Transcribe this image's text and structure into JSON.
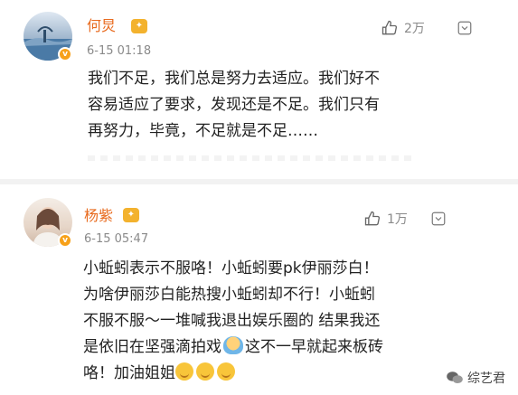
{
  "comments": [
    {
      "user": "何炅",
      "time": "6-15 01:18",
      "likes": "2万",
      "text": [
        "我们不足，我们总是努力去适应。我们好不",
        "容易适应了要求，发现还是不足。我们只有",
        "再努力，毕竟，不足就是不足……"
      ]
    },
    {
      "user": "杨紫",
      "time": "6-15 05:47",
      "likes": "1万",
      "text": [
        "小蚯蚓表示不服咯！小蚯蚓要pk伊丽莎白！",
        "为啥伊丽莎白能热搜小蚯蚓却不行！小蚯蚓",
        "不服不服～一堆喊我退出娱乐圈的 结果我还",
        "是依旧在坚强滴拍戏",
        "这不一早就起来板砖",
        "咯！加油姐姐"
      ]
    }
  ],
  "watermark": "综艺君",
  "icons": {
    "like": "thumbs-up-icon",
    "more": "chevron-down-icon",
    "verified": "verified-badge-icon",
    "vip": "vip-badge-icon"
  },
  "colors": {
    "username": "#e86b1f",
    "timestamp": "#8a8a8a",
    "verified": "#f7a11a"
  }
}
